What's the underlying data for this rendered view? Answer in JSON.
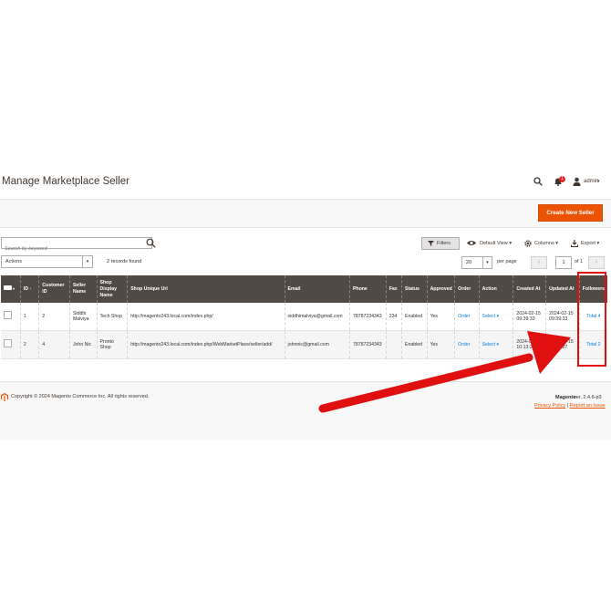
{
  "header": {
    "title": "Manage Marketplace Seller",
    "notification_count": "1",
    "user": "admin"
  },
  "toolbar": {
    "create_label": "Create New Seller",
    "search_placeholder": "Search by keyword",
    "filters_label": "Filters",
    "view_label": "Default View",
    "columns_label": "Columns",
    "export_label": "Export",
    "actions_label": "Actions",
    "records_found": "2 records found",
    "per_page_value": "20",
    "per_page_label": "per page",
    "page_value": "1",
    "page_of": "of 1"
  },
  "table": {
    "columns": [
      "ID",
      "Customer ID",
      "Seller Name",
      "Shop Display Name",
      "Shop Unique Url",
      "Email",
      "Phone",
      "Fax",
      "Status",
      "Approved",
      "Order",
      "Action",
      "Created At",
      "Updated At",
      "Followers"
    ],
    "rows": [
      {
        "id": "1",
        "customer_id": "2",
        "seller_name": "Siddhi Malviya",
        "shop_display_name": "Tech Shop",
        "shop_url": "http://magento243.local.com/index.php/",
        "email": "siddhimalviya@gmail.com",
        "phone": "78787234343",
        "fax": "234",
        "status": "Enabled",
        "approved": "Yes",
        "order": "Order",
        "action": "Select",
        "created_at": "2024-02-15 09:39:33",
        "updated_at": "2024-02-15 09:39:33",
        "followers": "Total 4"
      },
      {
        "id": "2",
        "customer_id": "4",
        "seller_name": "John Nic",
        "shop_display_name": "Pronto Shop",
        "shop_url": "http://magento243.local.com/index.php/WebMarketPlace/seller/add/",
        "email": "johnnic@gmail.com",
        "phone": "78787234343",
        "fax": "",
        "status": "Enabled",
        "approved": "Yes",
        "order": "Order",
        "action": "Select",
        "created_at": "2024-02-15 10:13:27",
        "updated_at": "2024-02-15 10:13:27",
        "followers": "Total 2"
      }
    ]
  },
  "footer": {
    "copyright": "Copyright © 2024 Magento Commerce Inc. All rights reserved.",
    "brand": "Magento",
    "version": "ver. 2.4.6-p3",
    "privacy": "Privacy Policy",
    "separator": "|",
    "report": "Report an Issue"
  },
  "colors": {
    "accent": "#eb5202",
    "table_header": "#514943",
    "link": "#007bdb",
    "highlight": "#e01010"
  },
  "icons": [
    "search-icon",
    "bell-icon",
    "user-icon",
    "eye-icon",
    "gear-icon",
    "download-icon",
    "magento-logo-icon"
  ]
}
